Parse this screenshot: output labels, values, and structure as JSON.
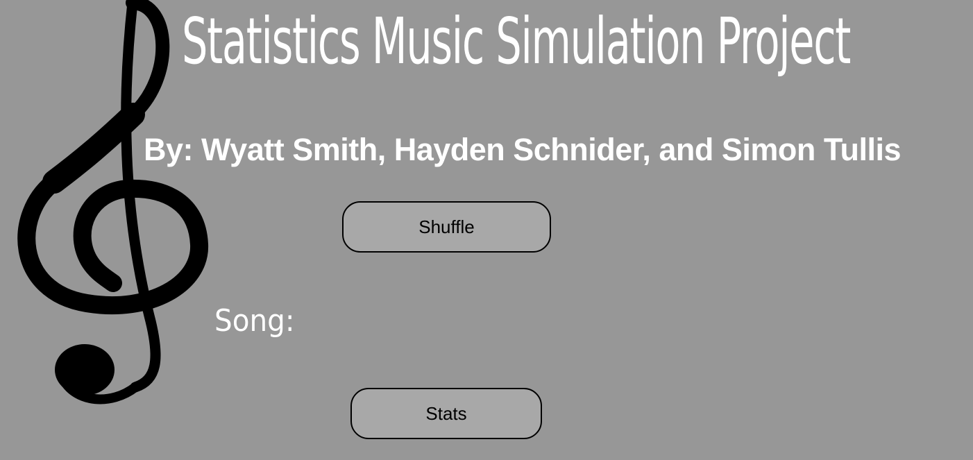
{
  "page": {
    "title": "Statistics Music Simulation Project",
    "authors": "By: Wyatt Smith, Hayden Schnider, and Simon Tullis",
    "song_label": "Song:"
  },
  "buttons": {
    "shuffle_label": "Shuffle",
    "stats_label": "Stats"
  },
  "decorations": {
    "background_image_icon": "treble-clef-icon"
  },
  "colors": {
    "background": "#979797",
    "text": "#ffffff",
    "button_fill": "#a8a8a8",
    "button_border": "#000000",
    "clef": "#000000"
  }
}
